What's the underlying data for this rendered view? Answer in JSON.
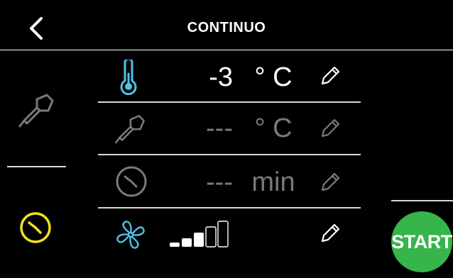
{
  "header": {
    "title": "CONTINUO"
  },
  "rows": [
    {
      "icon": "thermometer-icon",
      "value": "-3",
      "unit": "° C",
      "active": true
    },
    {
      "icon": "probe-icon",
      "value": "---",
      "unit": "° C",
      "active": false
    },
    {
      "icon": "clock-icon",
      "value": "---",
      "unit": "min",
      "active": false
    },
    {
      "icon": "fan-icon",
      "fan_level": 3,
      "fan_max": 5,
      "active": true
    }
  ],
  "sidebar_left": {
    "items": [
      {
        "icon": "probe-icon",
        "selected": false
      },
      {
        "icon": "clock-icon",
        "selected": true
      }
    ]
  },
  "start_button": {
    "label": "START",
    "color": "#36b54a"
  },
  "colors": {
    "accent_blue": "#4fc3e6",
    "accent_yellow": "#f2e21a",
    "dim_gray": "#7a7a7a"
  }
}
